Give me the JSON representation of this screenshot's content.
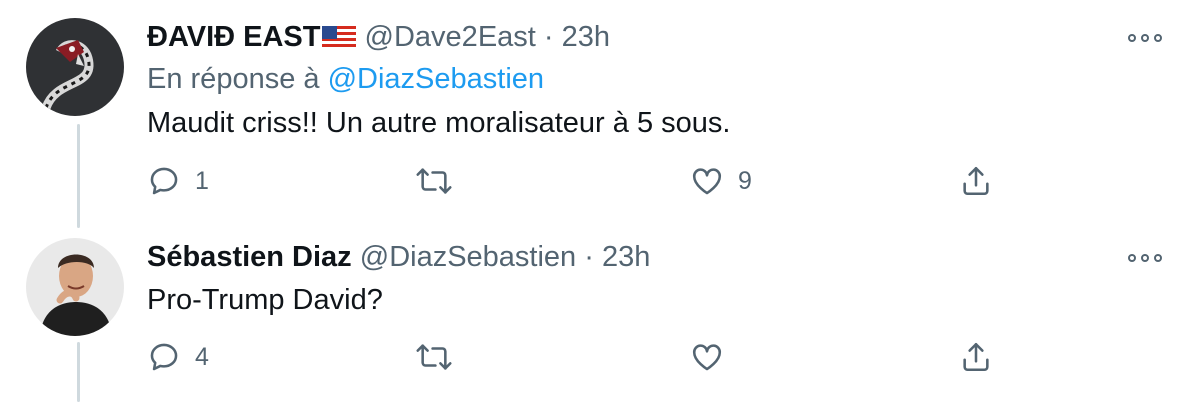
{
  "tweets": [
    {
      "author_name": "ĐAVIĐ EAST",
      "author_flag": "us-flag-emoji",
      "handle": "@Dave2East",
      "separator": "·",
      "time": "23h",
      "reply_prefix": "En réponse à",
      "reply_to": "@DiazSebastien",
      "text": "Maudit criss!! Un autre moralisateur à 5 sous.",
      "replies": "1",
      "retweets": "",
      "likes": "9"
    },
    {
      "author_name": "Sébastien Diaz",
      "handle": "@DiazSebastien",
      "separator": "·",
      "time": "23h",
      "text": "Pro-Trump David?",
      "replies": "4",
      "retweets": "",
      "likes": ""
    }
  ],
  "icons": {
    "reply": "speech-bubble-icon",
    "retweet": "retweet-arrows-icon",
    "like": "heart-outline-icon",
    "share": "share-upload-icon",
    "more": "three-dots-icon"
  },
  "colors": {
    "text": "#0f1419",
    "muted": "#536471",
    "link": "#1d9bf0",
    "thread_line": "#cfd9de"
  }
}
